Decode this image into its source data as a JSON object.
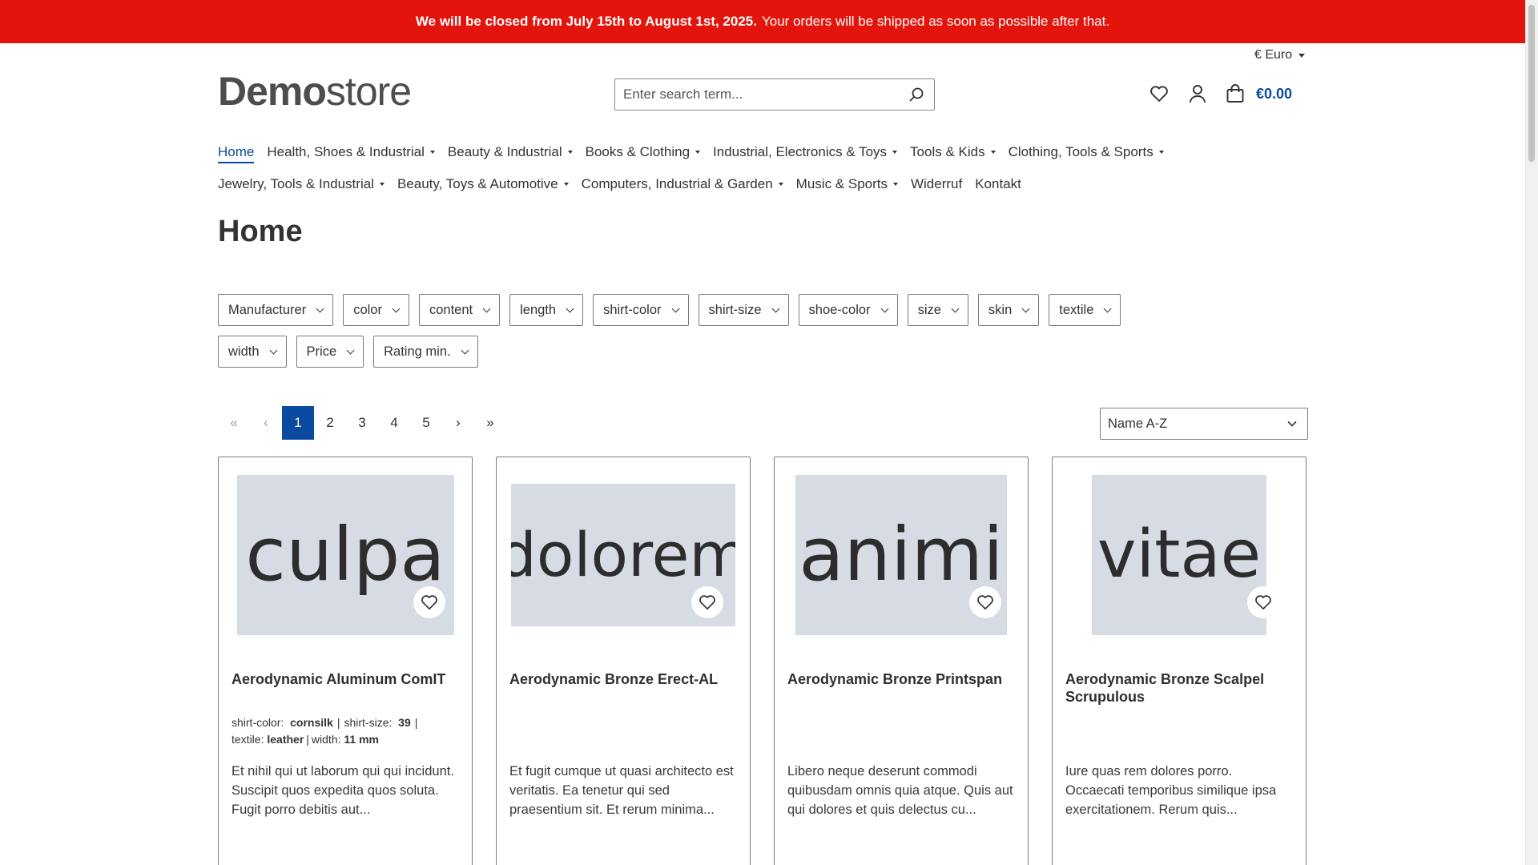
{
  "notice": {
    "bold": "We will be closed from July 15th to August 1st, 2025.",
    "text": "Your orders will be shipped as soon as possible after that."
  },
  "header": {
    "currency": "€ Euro",
    "logo_strong": "Demo",
    "logo_light": "store",
    "search_placeholder": "Enter search term...",
    "cart_total": "€0.00"
  },
  "nav": {
    "row1": [
      {
        "label": "Home",
        "dropdown": false
      },
      {
        "label": "Health, Shoes & Industrial",
        "dropdown": true
      },
      {
        "label": "Beauty & Industrial",
        "dropdown": true
      },
      {
        "label": "Books & Clothing",
        "dropdown": true
      },
      {
        "label": "Industrial, Electronics & Toys",
        "dropdown": true
      },
      {
        "label": "Tools & Kids",
        "dropdown": true
      },
      {
        "label": "Clothing, Tools & Sports",
        "dropdown": true
      }
    ],
    "row2": [
      {
        "label": "Jewelry, Tools & Industrial",
        "dropdown": true
      },
      {
        "label": "Beauty, Toys & Automotive",
        "dropdown": true
      },
      {
        "label": "Computers, Industrial & Garden",
        "dropdown": true
      },
      {
        "label": "Music & Sports",
        "dropdown": true
      },
      {
        "label": "Widerruf",
        "dropdown": false
      },
      {
        "label": "Kontakt",
        "dropdown": false
      }
    ]
  },
  "page_title": "Home",
  "filters": {
    "row1": [
      "Manufacturer",
      "color",
      "content",
      "length",
      "shirt-color",
      "shirt-size",
      "shoe-color",
      "size",
      "skin",
      "textile"
    ],
    "row2": [
      "width",
      "Price",
      "Rating min."
    ]
  },
  "pagination": {
    "first": "«",
    "prev": "‹",
    "pages": [
      "1",
      "2",
      "3",
      "4",
      "5"
    ],
    "current": "1",
    "next": "›",
    "last": "»"
  },
  "sort": {
    "selected": "Name A-Z"
  },
  "products": [
    {
      "image_word": "culpa",
      "name": "Aerodynamic Aluminum ComIT",
      "variants": [
        {
          "label": "shirt-color:",
          "value": "cornsilk"
        },
        {
          "label": "shirt-size:",
          "value": "39"
        },
        {
          "label": "textile:",
          "value": "leather"
        },
        {
          "label": "width:",
          "value": "11 mm"
        }
      ],
      "description": "Et nihil qui ut laborum qui qui incidunt. Suscipit quos expedita quos soluta. Fugit porro debitis aut..."
    },
    {
      "image_word": "dolorem",
      "name": "Aerodynamic Bronze Erect-AL",
      "variants": [],
      "description": "Et fugit cumque ut quasi architecto est veritatis. Ea tenetur qui sed praesentium sit. Et rerum minima..."
    },
    {
      "image_word": "animi",
      "name": "Aerodynamic Bronze Printspan",
      "variants": [],
      "description": "Libero neque deserunt commodi quibusdam omnis quia atque. Quis aut qui dolores et quis delectus cu..."
    },
    {
      "image_word": "vitae",
      "name": "Aerodynamic Bronze Scalpel Scrupulous",
      "variants": [],
      "description": "Iure quas rem dolores porro. Occaecati temporibus similique ipsa exercitationem. Rerum quis..."
    }
  ],
  "colors": {
    "notice_bg": "#e2140c",
    "accent": "#0b4aa1",
    "placeholder_bg": "#d6dbe4"
  },
  "icons": [
    "heart-icon",
    "user-icon",
    "bag-icon",
    "search-icon"
  ]
}
